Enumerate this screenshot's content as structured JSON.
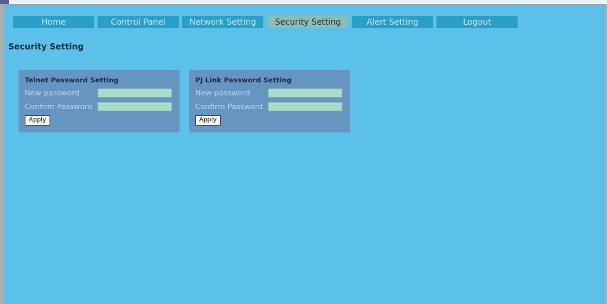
{
  "nav": {
    "tabs": [
      {
        "label": "Home"
      },
      {
        "label": "Control Panel"
      },
      {
        "label": "Network Setting"
      },
      {
        "label": "Security Setting"
      },
      {
        "label": "Alert Setting"
      },
      {
        "label": "Logout"
      }
    ],
    "active_tab": "Security Setting"
  },
  "page": {
    "title": "Security Setting"
  },
  "panels": [
    {
      "title": "Telnet Password Setting",
      "new_password_label": "New password",
      "new_password_value": "",
      "confirm_password_label": "Confirm Password",
      "confirm_password_value": "",
      "apply_label": "Apply"
    },
    {
      "title": "PJ Link Password Setting",
      "new_password_label": "New password",
      "new_password_value": "",
      "confirm_password_label": "Confirm Password",
      "confirm_password_value": "",
      "apply_label": "Apply"
    }
  ],
  "colors": {
    "background": "#5bc0ea",
    "tab": "#2aa0c8",
    "tab_active": "#8bbdb6",
    "panel": "#6795c2",
    "input": "#aadcc9"
  }
}
